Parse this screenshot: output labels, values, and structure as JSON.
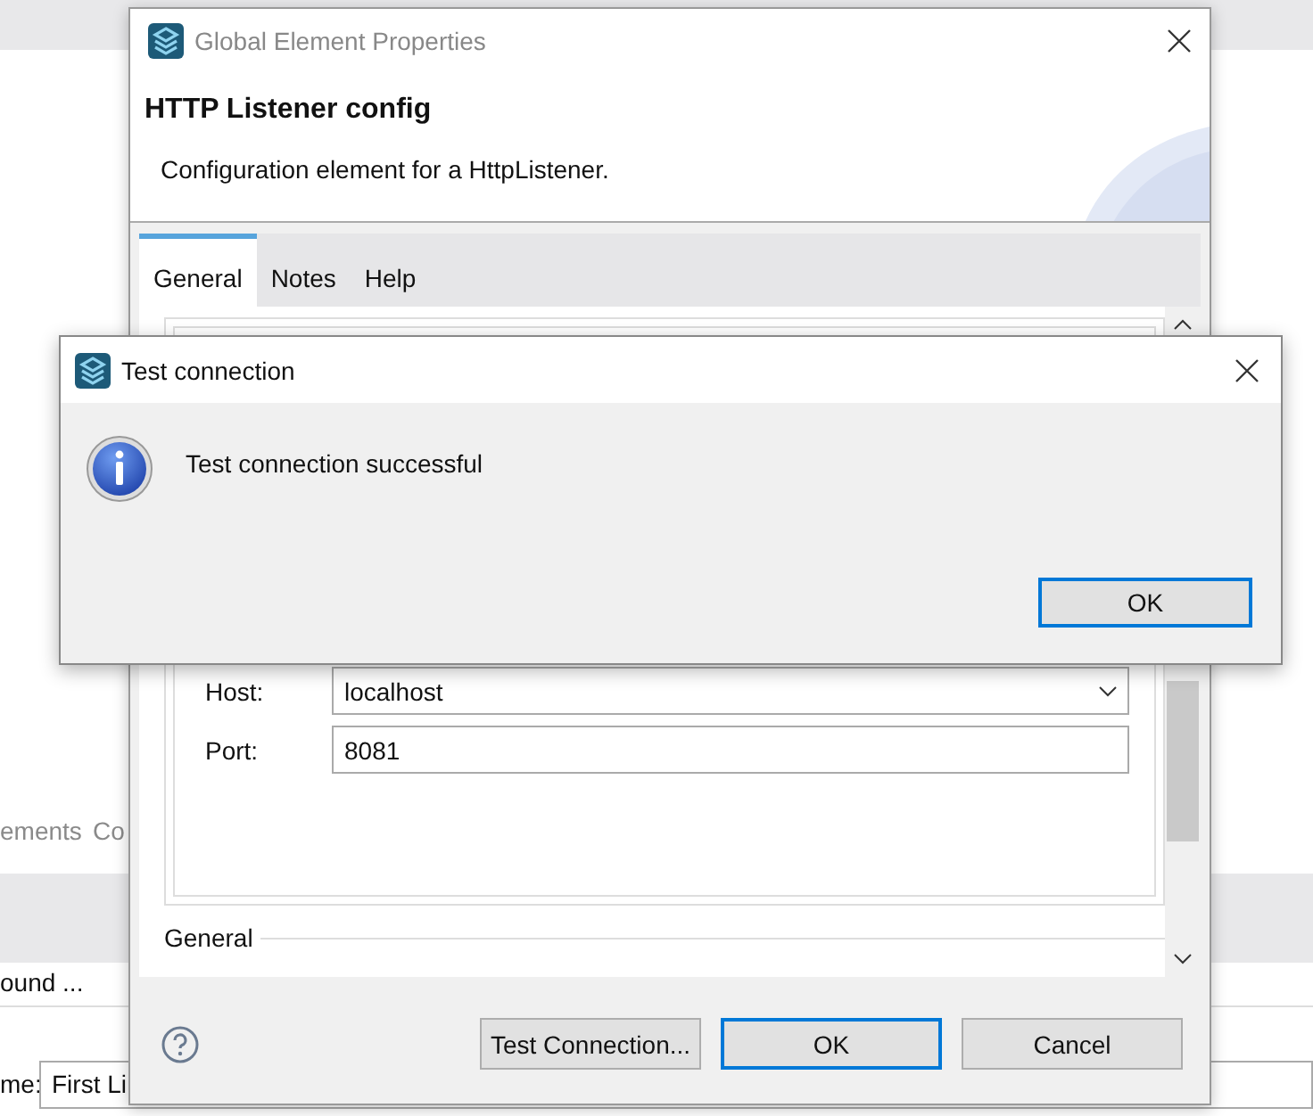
{
  "background": {
    "labels": [
      {
        "text": "ements",
        "kind": "muted"
      },
      {
        "text": "Co",
        "kind": "muted"
      },
      {
        "text": "ound ...",
        "kind": "plain"
      }
    ],
    "field": {
      "label": "me:",
      "value": "First Li"
    }
  },
  "dialog": {
    "title": "Global Element Properties",
    "heading": "HTTP Listener config",
    "description": "Configuration element for a HttpListener.",
    "tabs": [
      {
        "label": "General",
        "selected": true
      },
      {
        "label": "Notes",
        "selected": false
      },
      {
        "label": "Help",
        "selected": false
      }
    ],
    "fields": [
      {
        "label": "Host:",
        "value": "localhost",
        "kind": "combo"
      },
      {
        "label": "Port:",
        "value": "8081",
        "kind": "text"
      }
    ],
    "section": "General",
    "buttons": [
      {
        "label": "Test Connection...",
        "default": false
      },
      {
        "label": "OK",
        "default": true
      },
      {
        "label": "Cancel",
        "default": false
      }
    ]
  },
  "popup": {
    "title": "Test connection",
    "message": "Test connection successful",
    "button": {
      "label": "OK",
      "default": true
    }
  }
}
